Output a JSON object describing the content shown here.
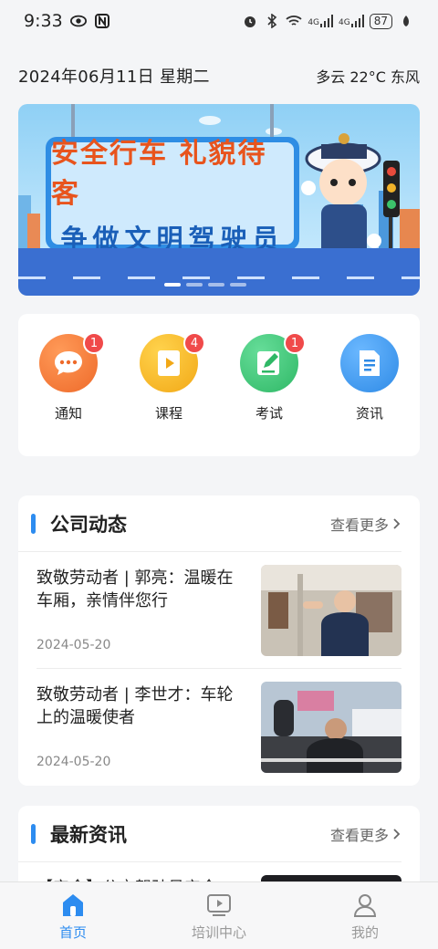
{
  "status": {
    "time": "9:33",
    "battery": "87",
    "signal1": "4G",
    "signal2": "4G"
  },
  "header": {
    "date": "2024年06月11日 星期二",
    "weather": "多云 22°C 东风"
  },
  "banner": {
    "line1": "安全行车  礼貌待客",
    "line2": "争做文明驾驶员",
    "active_slide": 1,
    "slide_count": 4
  },
  "quick": [
    {
      "label": "通知",
      "badge": "1",
      "icon": "message-icon",
      "color": "#f27b3c"
    },
    {
      "label": "课程",
      "badge": "4",
      "icon": "play-book-icon",
      "color": "#f5b322"
    },
    {
      "label": "考试",
      "badge": "1",
      "icon": "edit-icon",
      "color": "#3ecb7a"
    },
    {
      "label": "资讯",
      "badge": "",
      "icon": "document-icon",
      "color": "#3c9bf0"
    }
  ],
  "company_news": {
    "title": "公司动态",
    "more": "查看更多",
    "items": [
      {
        "title": "致敬劳动者 | 郭亮：温暖在车厢，亲情伴您行",
        "date": "2024-05-20"
      },
      {
        "title": "致敬劳动者 | 李世才：车轮上的温暖使者",
        "date": "2024-05-20"
      }
    ]
  },
  "latest_news": {
    "title": "最新资讯",
    "more": "查看更多",
    "items": [
      {
        "title": "【安全】公交驾驶员安全",
        "date": ""
      }
    ]
  },
  "tabs": [
    {
      "label": "首页",
      "icon": "home-icon",
      "active": true
    },
    {
      "label": "培训中心",
      "icon": "training-icon",
      "active": false
    },
    {
      "label": "我的",
      "icon": "profile-icon",
      "active": false
    }
  ],
  "colors": {
    "accent": "#2d8cf0",
    "badge": "#f04a4a"
  }
}
